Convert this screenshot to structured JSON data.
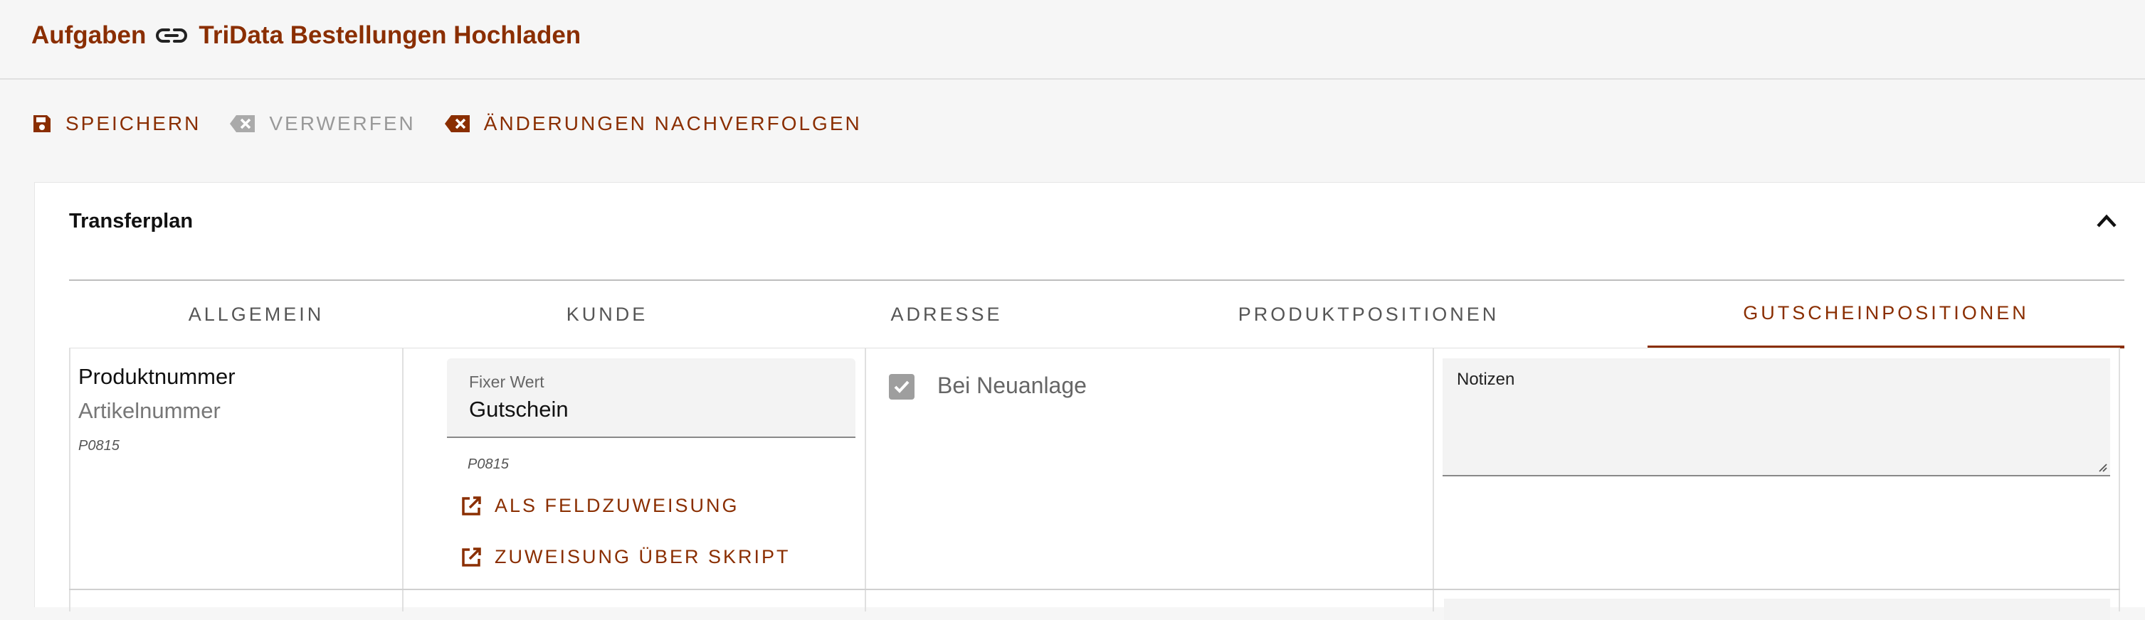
{
  "breadcrumb": {
    "parent": "Aufgaben",
    "current": "TriData Bestellungen Hochladen"
  },
  "toolbar": {
    "save_label": "SPEICHERN",
    "discard_label": "VERWERFEN",
    "track_label": "ÄNDERUNGEN NACHVERFOLGEN"
  },
  "card": {
    "title": "Transferplan"
  },
  "tabs": [
    {
      "label": "ALLGEMEIN"
    },
    {
      "label": "KUNDE"
    },
    {
      "label": "ADRESSE"
    },
    {
      "label": "PRODUKTPOSITIONEN"
    },
    {
      "label": "GUTSCHEINPOSITIONEN",
      "active": true
    }
  ],
  "row": {
    "field_title": "Produktnummer",
    "field_subtitle": "Artikelnummer",
    "field_code": "P0815",
    "fixed_label": "Fixer Wert",
    "fixed_value": "Gutschein",
    "value_code": "P0815",
    "assign_field_label": "ALS FELDZUWEISUNG",
    "assign_script_label": "ZUWEISUNG ÜBER SKRIPT",
    "checkbox_label": "Bei Neuanlage",
    "checkbox_checked": true,
    "notes_label": "Notizen"
  },
  "colors": {
    "accent": "#8a2e00",
    "disabled": "#999999"
  }
}
